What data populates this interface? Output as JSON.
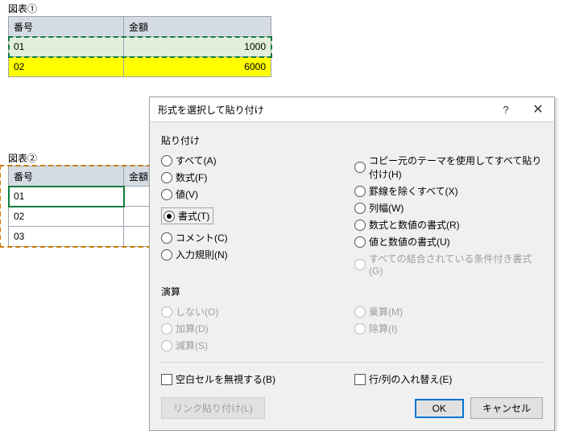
{
  "table1": {
    "label": "図表①",
    "headers": [
      "番号",
      "金額"
    ],
    "rows": [
      {
        "num": "01",
        "amount": "1000"
      },
      {
        "num": "02",
        "amount": "6000"
      }
    ]
  },
  "table2": {
    "label": "図表②",
    "headers": [
      "番号",
      "金額"
    ],
    "rows": [
      {
        "num": "01"
      },
      {
        "num": "02"
      },
      {
        "num": "03"
      }
    ]
  },
  "dialog": {
    "title": "形式を選択して貼り付け",
    "section_paste": "貼り付け",
    "section_calc": "演算",
    "opts": {
      "all": "すべて(A)",
      "formula": "数式(F)",
      "value": "値(V)",
      "format": "書式(T)",
      "comment": "コメント(C)",
      "validation": "入力規則(N)",
      "theme": "コピー元のテーマを使用してすべて貼り付け(H)",
      "noborder": "罫線を除くすべて(X)",
      "colwidth": "列幅(W)",
      "formnum": "数式と数値の書式(R)",
      "valnum": "値と数値の書式(U)",
      "condfmt": "すべての結合されている条件付き書式(G)",
      "none": "しない(O)",
      "add": "加算(D)",
      "sub": "減算(S)",
      "mul": "乗算(M)",
      "div": "除算(I)"
    },
    "checks": {
      "skipblank": "空白セルを無視する(B)",
      "transpose": "行/列の入れ替え(E)"
    },
    "buttons": {
      "pastelink": "リンク貼り付け(L)",
      "ok": "OK",
      "cancel": "キャンセル"
    }
  }
}
